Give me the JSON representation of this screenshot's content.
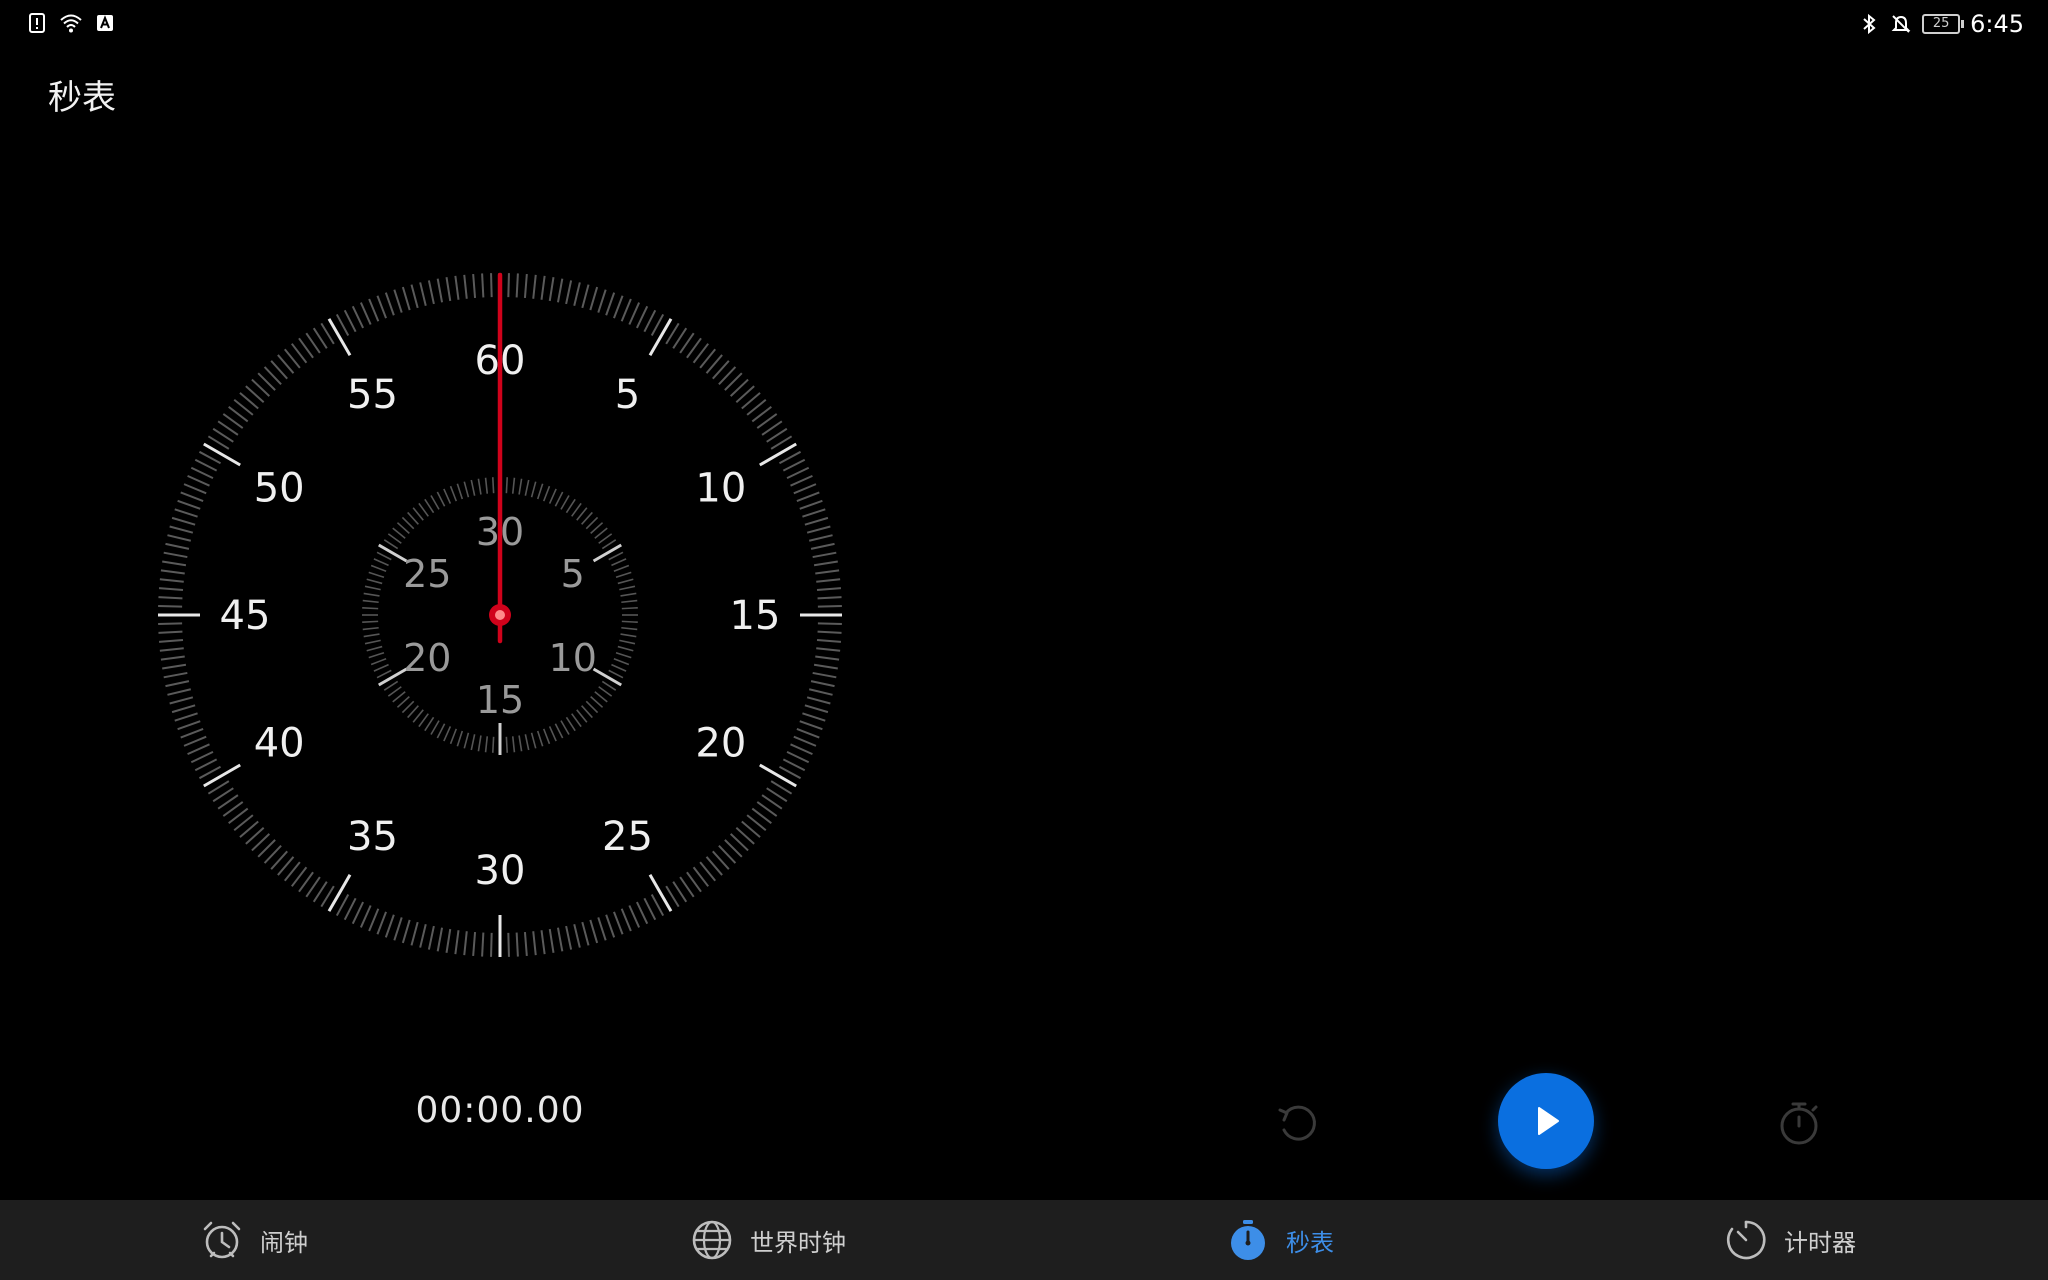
{
  "status_bar": {
    "left_icons": [
      "alert-icon",
      "wifi-icon",
      "keyboard-icon"
    ],
    "right_icons": [
      "bluetooth-icon",
      "mute-icon",
      "battery-icon"
    ],
    "battery_level": "25",
    "time": "6:45"
  },
  "page": {
    "title": "秒表"
  },
  "dial": {
    "outer_labels": [
      "60",
      "5",
      "10",
      "15",
      "20",
      "25",
      "30",
      "35",
      "40",
      "45",
      "50",
      "55"
    ],
    "inner_labels": [
      "30",
      "5",
      "10",
      "15",
      "20",
      "25"
    ],
    "hand_color": "#d0021b",
    "hand_seconds": 0
  },
  "readout": {
    "elapsed": "00:00.00"
  },
  "controls": {
    "reset_icon": "reset-icon",
    "play_icon": "play-icon",
    "lap_icon": "stopwatch-icon",
    "accent_color": "#0a6fe0"
  },
  "tabs": [
    {
      "label": "闹钟",
      "icon": "alarm-clock-icon",
      "active": false
    },
    {
      "label": "世界时钟",
      "icon": "globe-icon",
      "active": false
    },
    {
      "label": "秒表",
      "icon": "stopwatch-icon",
      "active": true
    },
    {
      "label": "计时器",
      "icon": "timer-icon",
      "active": false
    }
  ],
  "colors": {
    "background": "#000000",
    "tabbar": "#1e1e1e",
    "active_tab": "#3d8ee8"
  }
}
